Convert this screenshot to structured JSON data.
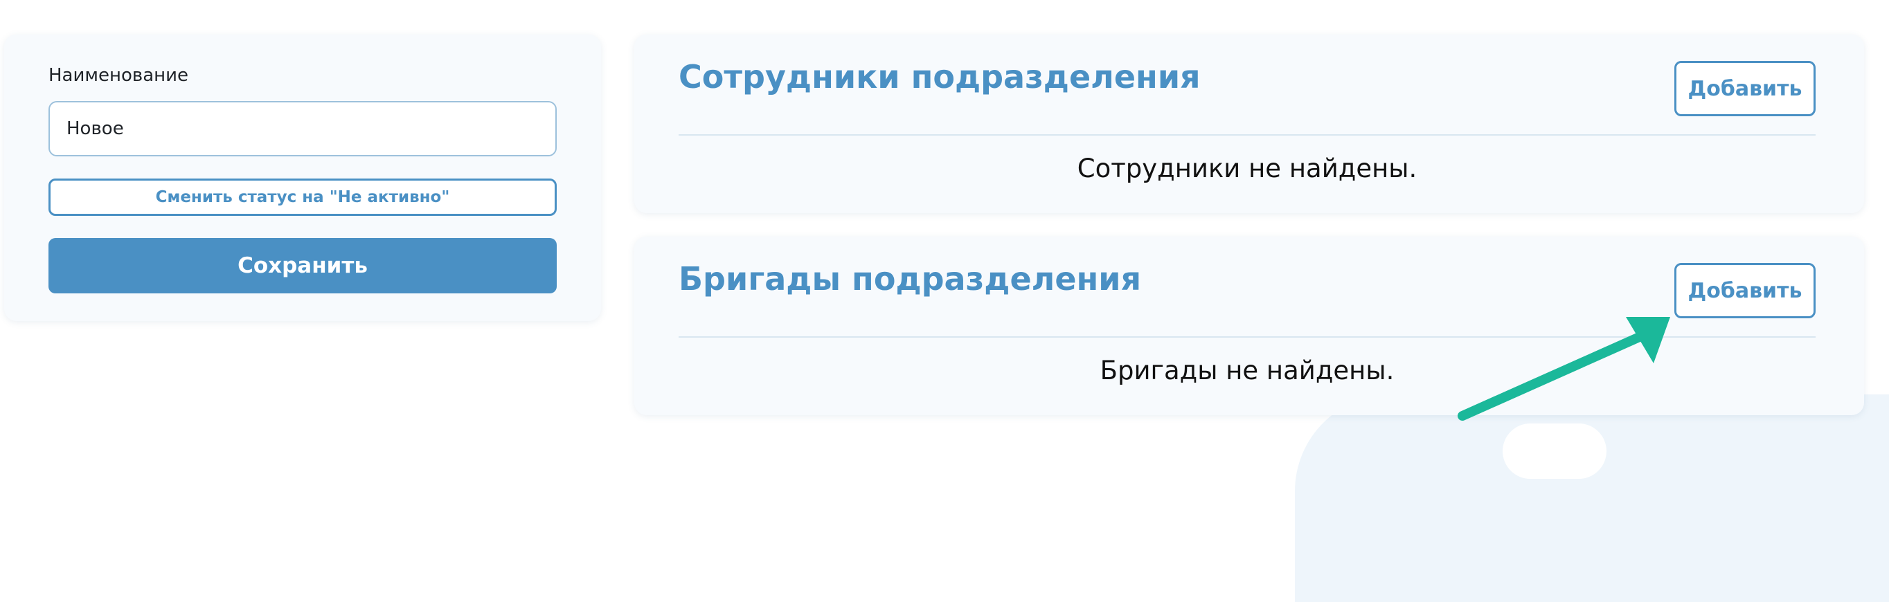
{
  "form": {
    "name_label": "Наименование",
    "name_value": "Новое",
    "status_button_label": "Сменить статус на \"Не активно\"",
    "save_button_label": "Сохранить"
  },
  "employees_section": {
    "title": "Сотрудники подразделения",
    "add_button_label": "Добавить",
    "empty_message": "Сотрудники не найдены."
  },
  "brigades_section": {
    "title": "Бригады подразделения",
    "add_button_label": "Добавить",
    "empty_message": "Бригады не найдены."
  },
  "colors": {
    "accent": "#4a90c4",
    "card_background": "#f7fafd",
    "annotation_arrow": "#1bb89a"
  },
  "annotation": {
    "icon": "arrow-icon",
    "points_to": "brigades-add-button"
  }
}
